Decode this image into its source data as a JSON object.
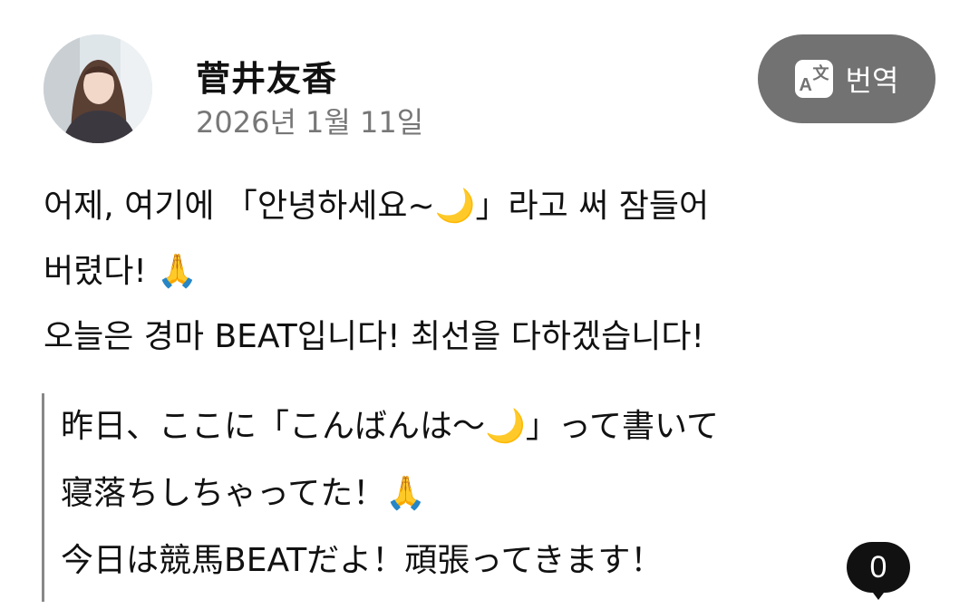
{
  "post": {
    "author": "菅井友香",
    "date": "2026년 1월 11일",
    "translate_label": "번역",
    "translated_lines": [
      "어제, 여기에 「안녕하세요~🌙」라고 써 잠들어",
      "버렸다! 🙏",
      "오늘은 경마 BEAT입니다! 최선을 다하겠습니다!"
    ],
    "original_lines": [
      "昨日、ここに「こんばんは〜🌙」って書いて",
      "寝落ちしちゃってた！🙏",
      "今日は競馬BEATだよ！頑張ってきます！"
    ],
    "comment_count": "0"
  },
  "icons": {
    "translate": "translate-icon",
    "avatar": "avatar-photo"
  },
  "colors": {
    "translate_button": "#727272",
    "date_text": "#777777",
    "quote_border": "#888888",
    "count_bubble": "#111111"
  }
}
